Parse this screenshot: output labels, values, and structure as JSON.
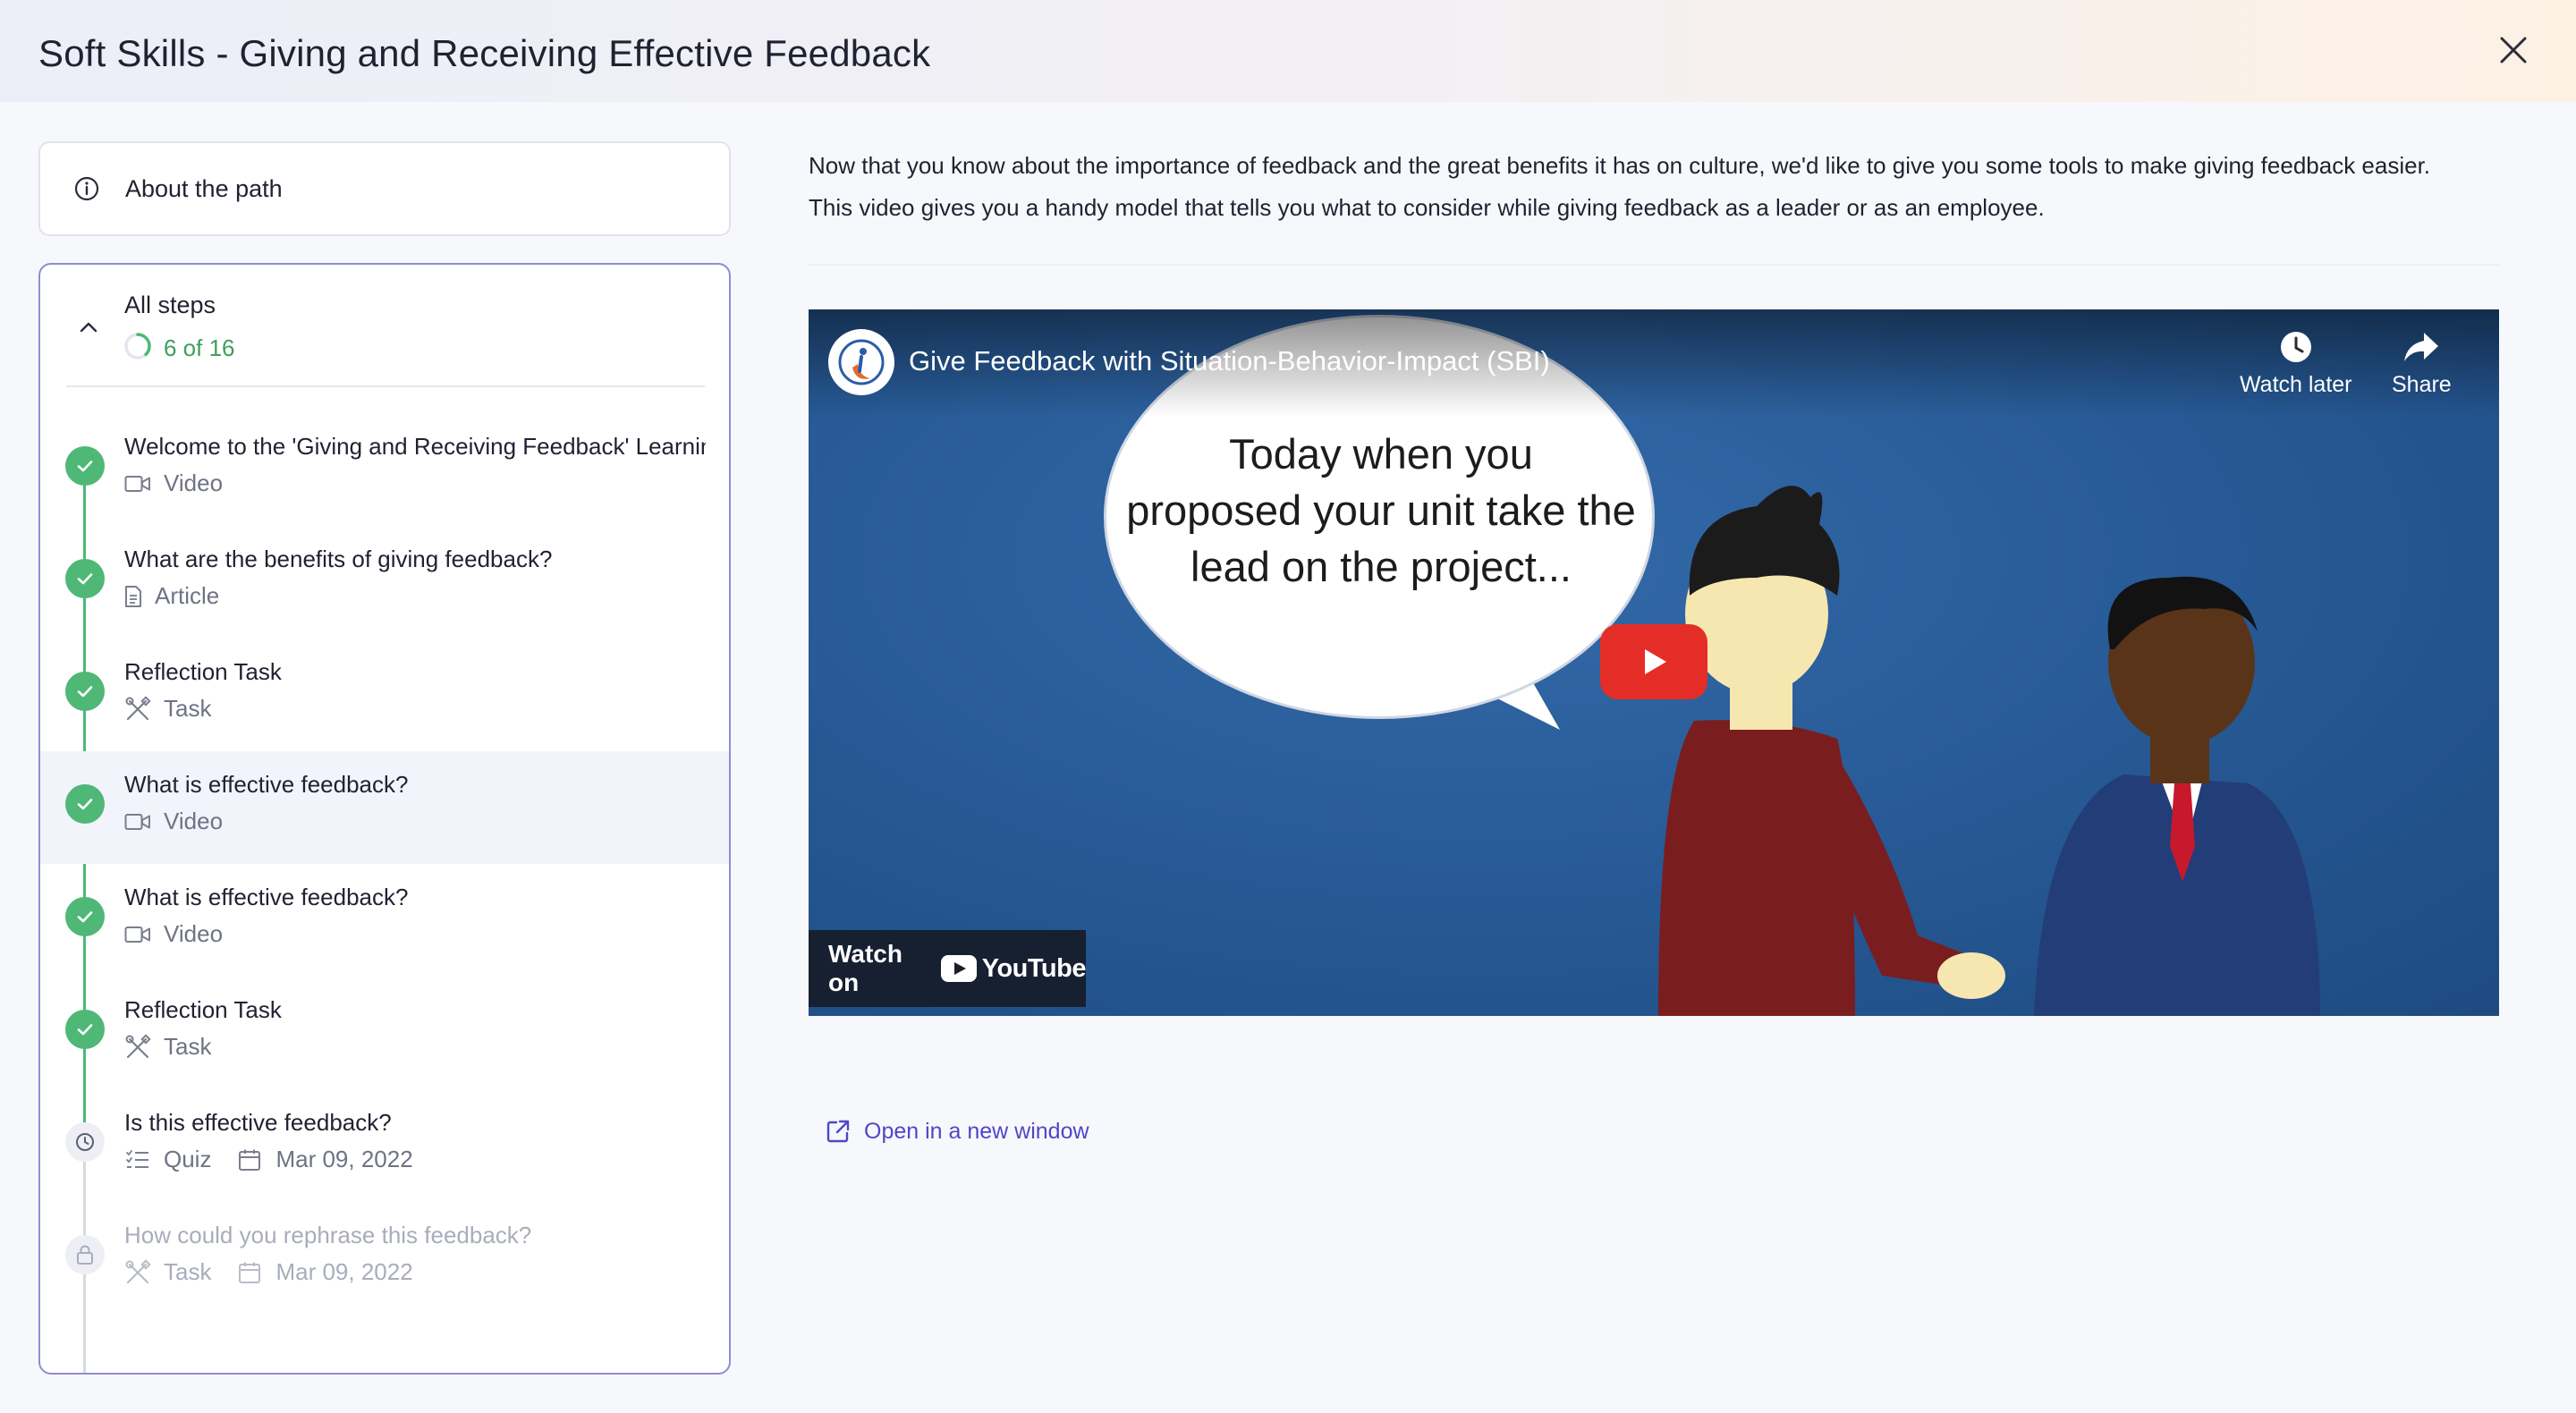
{
  "header": {
    "title": "Soft Skills - Giving and Receiving Effective Feedback"
  },
  "sidebar": {
    "about_label": "About the path",
    "steps_title": "All steps",
    "progress_text": "6 of 16",
    "progress_fraction": 0.375,
    "steps": [
      {
        "name": "Welcome to the 'Giving and Receiving Feedback' Learning Path",
        "type": "Video",
        "status": "done"
      },
      {
        "name": "What are the benefits of giving feedback?",
        "type": "Article",
        "status": "done"
      },
      {
        "name": "Reflection Task",
        "type": "Task",
        "status": "done"
      },
      {
        "name": "What is effective feedback?",
        "type": "Video",
        "status": "done",
        "active": true
      },
      {
        "name": "What is effective feedback?",
        "type": "Video",
        "status": "done"
      },
      {
        "name": "Reflection Task",
        "type": "Task",
        "status": "done"
      },
      {
        "name": "Is this effective feedback?",
        "type": "Quiz",
        "date": "Mar 09, 2022",
        "status": "pending"
      },
      {
        "name": "How could you rephrase this feedback?",
        "type": "Task",
        "date": "Mar 09, 2022",
        "status": "locked"
      }
    ]
  },
  "main": {
    "description_line1": "Now that you know about the importance of feedback and the great benefits it has on culture, we'd like to give you some tools to make giving feedback easier.",
    "description_line2": "This video gives you a handy model that tells you what to consider while giving feedback as a leader or as an employee.",
    "video": {
      "title": "Give Feedback with Situation-Behavior-Impact (SBI)",
      "watch_later_label": "Watch later",
      "share_label": "Share",
      "bubble_line1": "Today when you",
      "bubble_line2": "proposed your unit take the",
      "bubble_line3": "lead on the project...",
      "watch_on_label": "Watch on",
      "youtube_word": "YouTube"
    },
    "open_new_window_label": "Open in a new window"
  },
  "colors": {
    "accent": "#4f46c9",
    "done_green": "#4fb877",
    "panel_border": "#8f8cd6",
    "youtube_red": "#e52d27"
  }
}
